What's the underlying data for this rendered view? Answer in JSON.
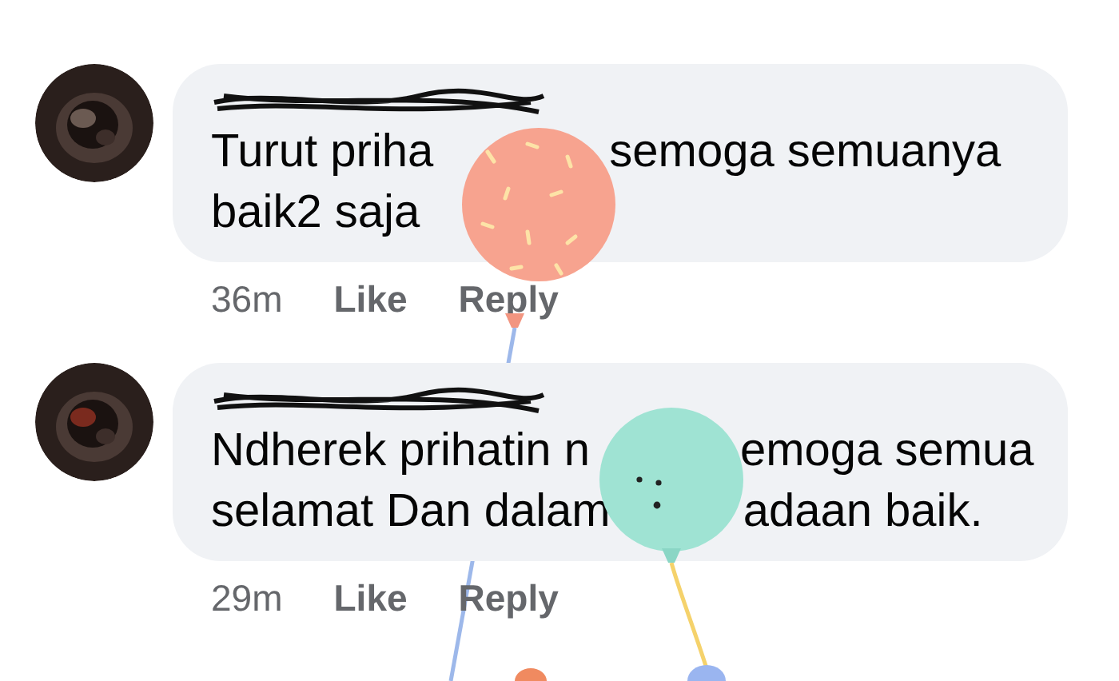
{
  "comments": [
    {
      "lines": [
        [
          "Turut priha",
          "semoga semuanya"
        ],
        [
          "baik2 saja"
        ]
      ],
      "time": "36m",
      "like": "Like",
      "reply": "Reply"
    },
    {
      "lines": [
        [
          "Ndherek prihatin n",
          "emoga semua"
        ],
        [
          "selamat Dan dalam",
          "adaan baik."
        ]
      ],
      "time": "29m",
      "like": "Like",
      "reply": "Reply"
    }
  ]
}
